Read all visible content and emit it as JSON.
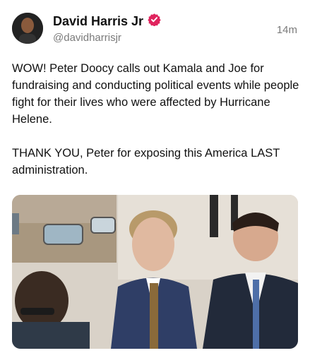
{
  "post": {
    "display_name": "David Harris Jr",
    "handle": "@davidharrisjr",
    "time": "14m",
    "text": "WOW! Peter Doocy calls out Kamala and Joe for fundraising and conducting political events while people fight for their lives who were affected by Hurricane Helene.\n\nTHANK YOU, Peter for exposing this America LAST administration."
  },
  "icons": {
    "verified": "verified-badge-icon",
    "verified_color": "#e0245e"
  }
}
